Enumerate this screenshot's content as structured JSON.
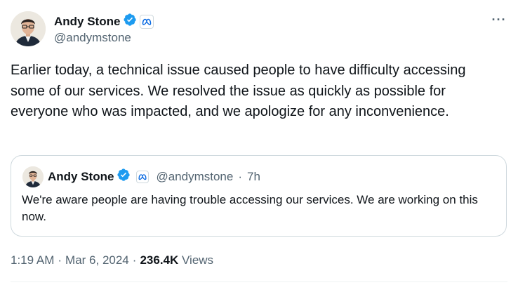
{
  "tweet": {
    "author_name": "Andy Stone",
    "author_handle": "@andymstone",
    "text": "Earlier today, a technical issue caused people to have difficulty accessing some of our services. We resolved the issue as quickly as possible for everyone who was impacted, and we apologize for any inconvenience.",
    "time": "1:19 AM",
    "date": "Mar 6, 2024",
    "views_count": "236.4K",
    "views_label": "Views",
    "more_icon": "···"
  },
  "quote": {
    "author_name": "Andy Stone",
    "author_handle": "@andymstone",
    "separator": "·",
    "age": "7h",
    "text": "We're aware people are having trouble accessing our services. We are working on this now."
  },
  "icons": {
    "verified": "verified-badge-icon",
    "affiliation": "meta-affiliation-icon",
    "more": "more-options-icon"
  },
  "colors": {
    "verified_blue": "#1d9bf0",
    "affiliation_blue": "#0668e1",
    "secondary_text": "#536471",
    "border": "#cfd9de"
  }
}
